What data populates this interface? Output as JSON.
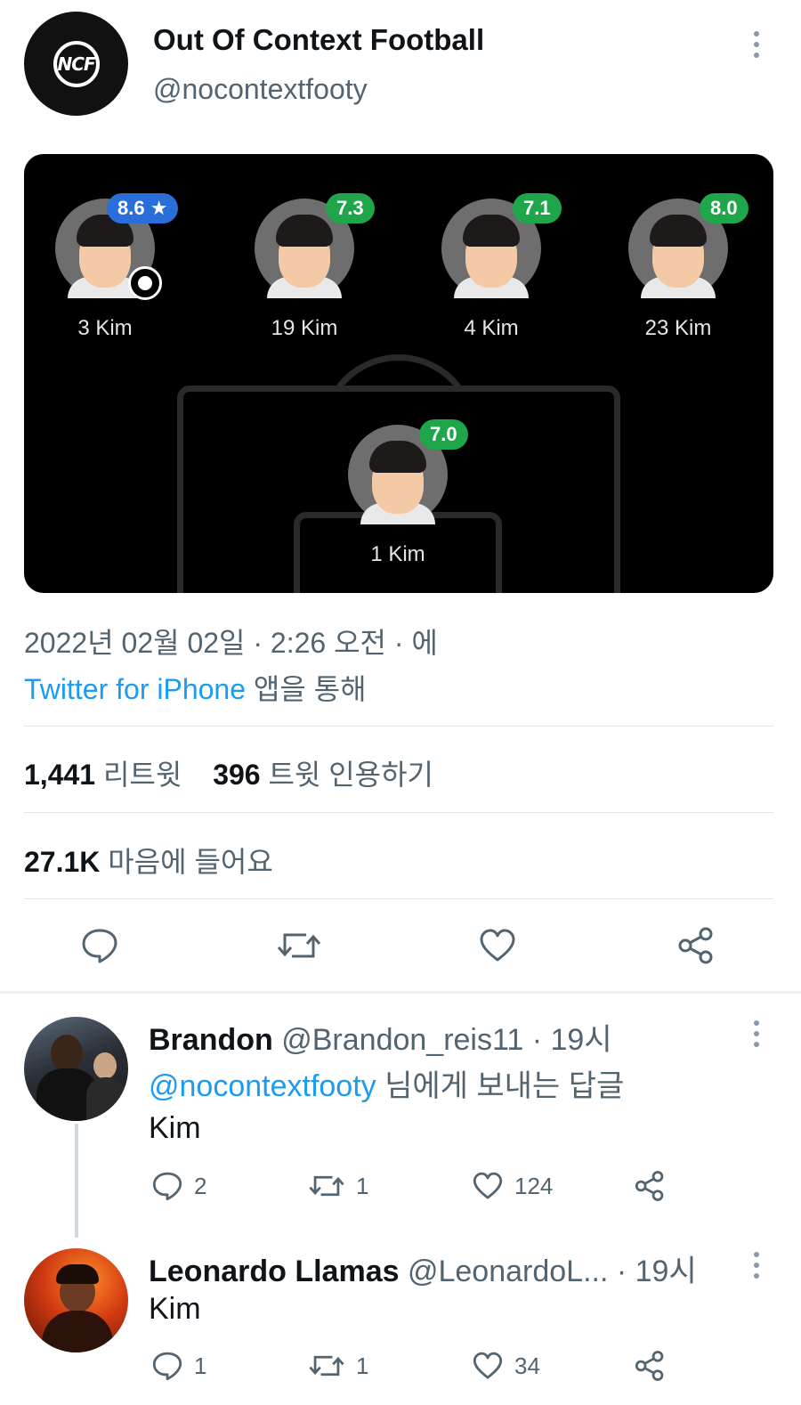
{
  "tweet": {
    "author_name": "Out Of Context Football",
    "author_handle": "@nocontextfooty",
    "avatar_text": "NCF",
    "date_line": "2022년 02월 02일 · 2:26 오전 · 에",
    "source_app": "Twitter for iPhone",
    "source_suffix": " 앱을 통해",
    "retweets_count": "1,441",
    "retweets_label": " 리트윗",
    "quotes_count": "396",
    "quotes_label": " 트윗 인용하기",
    "likes_count": "27.1K",
    "likes_label": " 마음에 들어요"
  },
  "lineup": {
    "players": [
      {
        "name": "3 Kim",
        "rating": "8.6 ★",
        "badge": "blue",
        "motm": true
      },
      {
        "name": "19 Kim",
        "rating": "7.3",
        "badge": "green"
      },
      {
        "name": "4 Kim",
        "rating": "7.1",
        "badge": "green"
      },
      {
        "name": "23 Kim",
        "rating": "8.0",
        "badge": "green"
      },
      {
        "name": "1 Kim",
        "rating": "7.0",
        "badge": "green"
      }
    ]
  },
  "replies": [
    {
      "name": "Brandon",
      "handle": "@Brandon_reis11",
      "time": " · 19시",
      "reply_to_handle": "@nocontextfooty",
      "reply_to_suffix": " 님에게 보내는 답글",
      "text": "Kim",
      "comments": "2",
      "retweets": "1",
      "likes": "124"
    },
    {
      "name": "Leonardo Llamas",
      "handle": "@LeonardoL...",
      "time": " · 19시",
      "text": "Kim",
      "comments": "1",
      "retweets": "1",
      "likes": "34"
    }
  ],
  "colors": {
    "link": "#1d9bf0",
    "rating_green": "#1fa64a",
    "rating_blue": "#2a6fd9"
  }
}
